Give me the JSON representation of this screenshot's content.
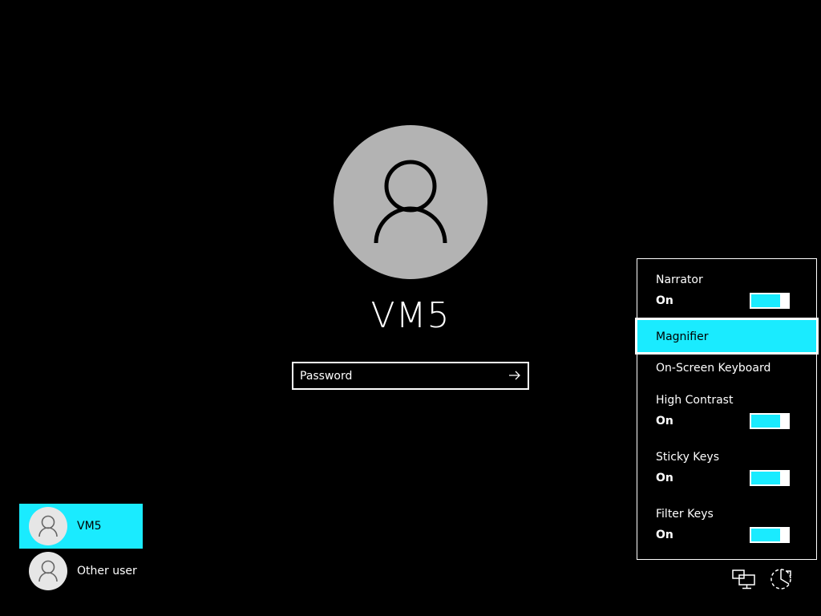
{
  "login": {
    "username": "VM5",
    "password_placeholder": "Password"
  },
  "user_list": [
    {
      "name": "VM5",
      "selected": true
    },
    {
      "name": "Other user",
      "selected": false
    }
  ],
  "ease_of_access": {
    "narrator": {
      "label": "Narrator",
      "state": "On"
    },
    "magnifier": {
      "label": "Magnifier"
    },
    "onscreen_keyboard": {
      "label": "On-Screen Keyboard"
    },
    "high_contrast": {
      "label": "High Contrast",
      "state": "On"
    },
    "sticky_keys": {
      "label": "Sticky Keys",
      "state": "On"
    },
    "filter_keys": {
      "label": "Filter Keys",
      "state": "On"
    }
  },
  "icons": {
    "network": "network-icon",
    "ease": "ease-of-access-icon",
    "arrow": "arrow-right-icon",
    "user": "user-icon"
  },
  "colors": {
    "accent": "#1aebff",
    "avatar_bg": "#b3b3b3",
    "background": "#000000"
  }
}
